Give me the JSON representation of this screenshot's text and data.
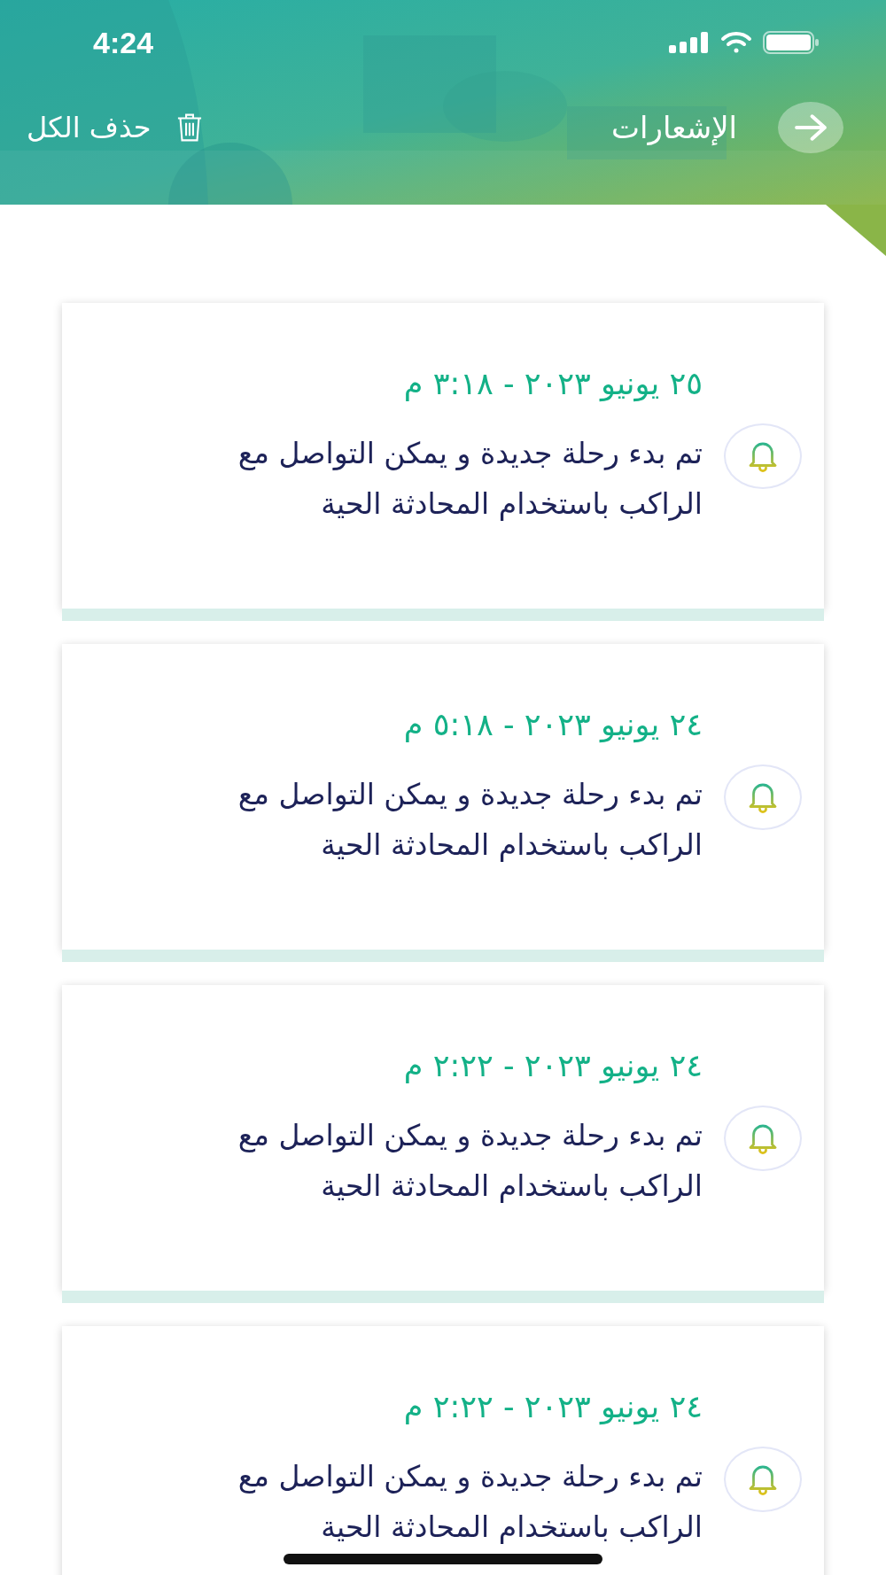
{
  "status_bar": {
    "time": "4:24"
  },
  "header": {
    "title": "الإشعارات",
    "delete_all": "حذف الكل"
  },
  "notifications": [
    {
      "date": "٢٥ يونيو ٢٠٢٣ - ٣:١٨ م",
      "message": "تم بدء رحلة جديدة و يمكن التواصل مع الراكب باستخدام المحادثة الحية"
    },
    {
      "date": "٢٤ يونيو ٢٠٢٣ - ٥:١٨ م",
      "message": "تم بدء رحلة جديدة و يمكن التواصل مع الراكب باستخدام المحادثة الحية"
    },
    {
      "date": "٢٤ يونيو ٢٠٢٣ - ٢:٢٢ م",
      "message": "تم بدء رحلة جديدة و يمكن التواصل مع الراكب باستخدام المحادثة الحية"
    },
    {
      "date": "٢٤ يونيو ٢٠٢٣ - ٢:٢٢ م",
      "message": "تم بدء رحلة جديدة و يمكن التواصل مع الراكب باستخدام المحادثة الحية"
    }
  ]
}
